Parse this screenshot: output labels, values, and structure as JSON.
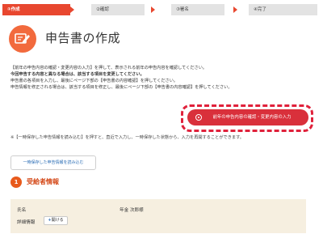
{
  "steps": [
    {
      "label": "①作成"
    },
    {
      "label": "②確認"
    },
    {
      "label": "③署名"
    },
    {
      "label": "④完了"
    }
  ],
  "header": {
    "title": "申告書の作成",
    "icon": "edit-document-icon"
  },
  "instructions": {
    "line1": "【前年の申告内容の確認・変更内容の入力】を押して、表示される前年の申告内容を確認してください。",
    "line2": "今回申告する内容と異なる場合は、該当する項目を変更してください。",
    "line3": "申告書の各項目を入力し、最後にページ下部の【申告書の内容確認】を押してください。",
    "line4": "申告情報を修正される場合は、該当する項目を修正し、最後にページ下部の【申告書の内容確認】を押してください。"
  },
  "confirm_button": {
    "label": "前年の申告内容の確認・変更内容の入力",
    "icon": "circle-dot-icon"
  },
  "note": "※【一時保存した申告情報を読み込む】を押すと、直近で入力し、一時保存した状態から、入力を再開することができます。",
  "load_button": {
    "label": "一時保存した申告情報を読み込む"
  },
  "section": {
    "number": "1",
    "title": "受給者情報"
  },
  "recipient": {
    "name_label": "氏名",
    "name_value": "年金 次郎様",
    "detail_label": "詳細情報",
    "open_button": {
      "plus": "+",
      "label": "開ける"
    }
  },
  "colors": {
    "accent": "#e8472f",
    "button_red": "#d9303b",
    "section_orange": "#e85a1c",
    "info_bg": "#f6efe0"
  }
}
